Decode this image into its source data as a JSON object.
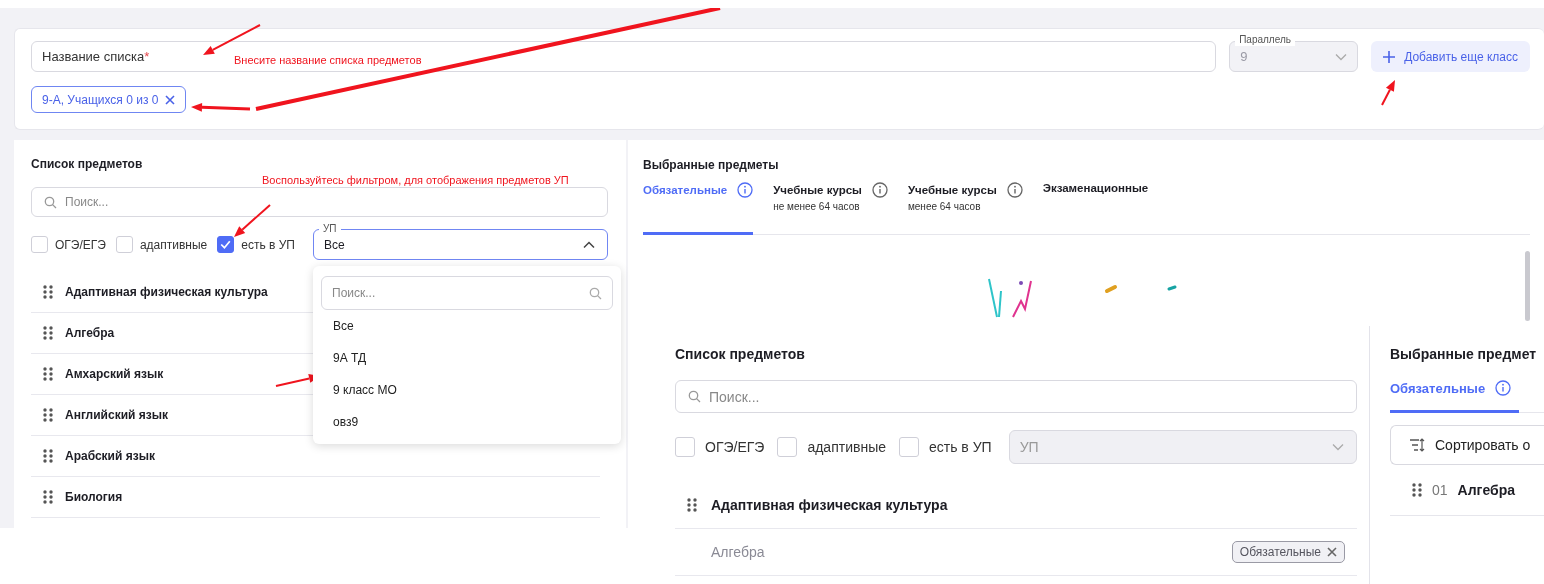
{
  "form": {
    "name_field": {
      "placeholder": "Название списка",
      "required_mark": "*"
    },
    "parallel_select": {
      "label": "Параллель",
      "value": "9",
      "disabled": true
    },
    "add_class_button": {
      "label": "Добавить еще класс"
    },
    "class_chips": [
      {
        "label": "9-А, Учащихся 0 из 0"
      }
    ]
  },
  "subject_list": {
    "title": "Список предметов",
    "search": {
      "placeholder": "Поиск..."
    },
    "filters": [
      {
        "label": "ОГЭ/ЕГЭ",
        "checked": false
      },
      {
        "label": "адаптивные",
        "checked": false
      },
      {
        "label": "есть в УП",
        "checked": true
      }
    ],
    "up_select": {
      "label": "УП",
      "value": "Все",
      "expanded": true,
      "disabled": false,
      "menu": {
        "search_placeholder": "Поиск...",
        "options": [
          "Все",
          "9А ТД",
          "9 класс МО",
          "овз9"
        ]
      }
    },
    "subjects": [
      {
        "name": "Адаптивная физическая культура",
        "added": false
      },
      {
        "name": "Алгебра",
        "added": false
      },
      {
        "name": "Амхарский язык",
        "added": false
      },
      {
        "name": "Английский язык",
        "added": false
      },
      {
        "name": "Арабский язык",
        "added": false
      },
      {
        "name": "Биология",
        "added": false
      }
    ]
  },
  "selected_subjects": {
    "title": "Выбранные предметы",
    "tabs": [
      {
        "label": "Обязательные",
        "info": true,
        "selected": true
      },
      {
        "label": "Учебные курсы",
        "sublabel": "не менее 64 часов",
        "info": true,
        "selected": false
      },
      {
        "label": "Учебные курсы",
        "sublabel": "менее 64 часов",
        "info": true,
        "selected": false
      },
      {
        "label": "Экзаменационные",
        "info": false,
        "selected": false
      }
    ]
  },
  "preview": {
    "subject_list": {
      "title": "Список предметов",
      "search": {
        "placeholder": "Поиск..."
      },
      "filters": [
        {
          "label": "ОГЭ/ЕГЭ",
          "checked": false
        },
        {
          "label": "адаптивные",
          "checked": false
        },
        {
          "label": "есть в УП",
          "checked": false
        }
      ],
      "up_select": {
        "placeholder": "УП",
        "expanded": false,
        "disabled": true
      },
      "subjects": [
        {
          "name": "Адаптивная физическая культура",
          "added": false
        },
        {
          "name": "Алгебра",
          "added": true,
          "tag": "Обязательные"
        }
      ]
    },
    "selected_subjects": {
      "title": "Выбранные предмет",
      "tabs": [
        {
          "label": "Обязательные",
          "info": true,
          "selected": true
        }
      ],
      "sort_button": {
        "label": "Сортировать о"
      },
      "items": [
        {
          "number": "01",
          "name": "Алгебра"
        }
      ]
    }
  },
  "annotations": [
    {
      "text": "Внесите название списка предметов"
    },
    {
      "text": "Воспользуйтесь фильтром, для отображения предметов УП"
    }
  ]
}
